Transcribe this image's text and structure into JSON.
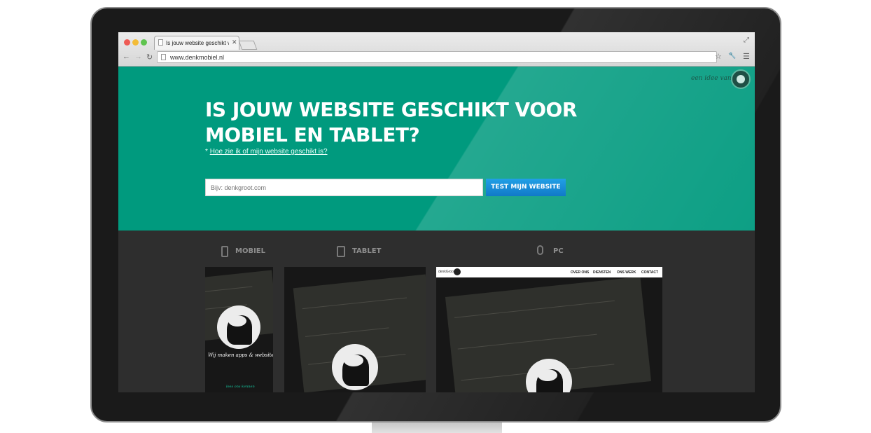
{
  "browser": {
    "tab_title": "Is jouw website geschikt v",
    "tab_close": "✕",
    "url": "www.denkmobiel.nl",
    "back_icon": "←",
    "forward_icon": "→",
    "reload_icon": "↻",
    "star_icon": "☆",
    "wrench_icon": "🔧",
    "menu_icon": "☰",
    "expand_icon": "⤢"
  },
  "hero": {
    "tagline": "een idee van",
    "title": "IS JOUW WEBSITE GESCHIKT VOOR MOBIEL EN TABLET?",
    "help_prefix": "*",
    "help_link": "Hoe zie ik of mijn website geschikt is?",
    "input_placeholder": "Bijv: denkgroot.com",
    "button_label": "TEST MIJN WEBSITE"
  },
  "devices": {
    "mobiel": "MOBIEL",
    "tablet": "TABLET",
    "pc": "PC"
  },
  "previews": {
    "mobile_caption": "Wij maken apps & websites",
    "mobile_sub": "lees ons kennen",
    "pc_brand": "denkGroot",
    "pc_menu": [
      "OVER ONS",
      "DIENSTEN",
      "ONS WERK",
      "CONTACT"
    ]
  },
  "colors": {
    "hero": "#009a7e",
    "button": "#1a8fd8",
    "dark": "#2e2e2e"
  }
}
